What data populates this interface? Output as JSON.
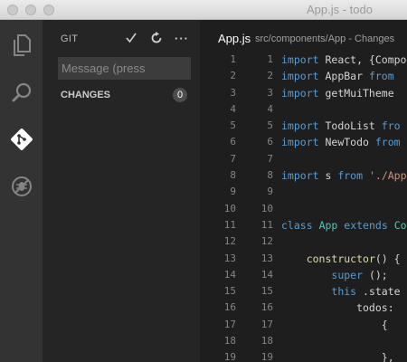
{
  "window": {
    "title": "App.js - todo"
  },
  "activity_bar": {
    "items": [
      {
        "icon": "files-icon",
        "active": false
      },
      {
        "icon": "search-icon",
        "active": false
      },
      {
        "icon": "git-icon",
        "active": true
      },
      {
        "icon": "debug-icon",
        "active": false
      }
    ]
  },
  "sidebar": {
    "title": "GIT",
    "actions": [
      "commit-check-icon",
      "refresh-icon",
      "more-icon"
    ],
    "more_label": "···",
    "message_placeholder": "Message (press",
    "changes_label": "CHANGES",
    "changes_count": "0"
  },
  "editor": {
    "tab_file": "App.js",
    "tab_path": "src/components/App - Changes",
    "lines": [
      {
        "left": "1",
        "right": "1",
        "tokens": [
          [
            "kw",
            "import"
          ],
          [
            "",
            "React, {Compo"
          ]
        ]
      },
      {
        "left": "2",
        "right": "2",
        "tokens": [
          [
            "kw",
            "import"
          ],
          [
            "",
            "AppBar "
          ],
          [
            "kw",
            "from"
          ]
        ]
      },
      {
        "left": "3",
        "right": "3",
        "tokens": [
          [
            "kw",
            "import"
          ],
          [
            "",
            "getMuiTheme "
          ]
        ]
      },
      {
        "left": "4",
        "right": "4",
        "tokens": []
      },
      {
        "left": "5",
        "right": "5",
        "tokens": [
          [
            "kw",
            "import"
          ],
          [
            "",
            "TodoList "
          ],
          [
            "kw",
            "fro"
          ]
        ]
      },
      {
        "left": "6",
        "right": "6",
        "tokens": [
          [
            "kw",
            "import"
          ],
          [
            "",
            "NewTodo "
          ],
          [
            "kw",
            "from"
          ]
        ]
      },
      {
        "left": "7",
        "right": "7",
        "tokens": []
      },
      {
        "left": "8",
        "right": "8",
        "tokens": [
          [
            "kw",
            "import"
          ],
          [
            "",
            "s "
          ],
          [
            "kw",
            "from"
          ],
          [
            "",
            " "
          ],
          [
            "str",
            "'./App"
          ]
        ]
      },
      {
        "left": "9",
        "right": "9",
        "tokens": []
      },
      {
        "left": "10",
        "right": "10",
        "tokens": []
      },
      {
        "left": "11",
        "right": "11",
        "tokens": [
          [
            "kw",
            "class"
          ],
          [
            "",
            " "
          ],
          [
            "cls",
            "App"
          ],
          [
            "",
            " "
          ],
          [
            "kw",
            "extends"
          ],
          [
            "",
            " "
          ],
          [
            "cls",
            "Co"
          ]
        ]
      },
      {
        "left": "12",
        "right": "12",
        "tokens": []
      },
      {
        "left": "13",
        "right": "13",
        "tokens": [
          [
            "",
            "    "
          ],
          [
            "fn",
            "constructor"
          ],
          [
            "",
            "() {"
          ]
        ]
      },
      {
        "left": "14",
        "right": "14",
        "tokens": [
          [
            "",
            "        "
          ],
          [
            "kw",
            "super"
          ],
          [
            "",
            "();"
          ]
        ]
      },
      {
        "left": "15",
        "right": "15",
        "tokens": [
          [
            "",
            "        "
          ],
          [
            "kw",
            "this"
          ],
          [
            "",
            ".state ="
          ]
        ]
      },
      {
        "left": "16",
        "right": "16",
        "tokens": [
          [
            "",
            "            todos:"
          ]
        ]
      },
      {
        "left": "17",
        "right": "17",
        "tokens": [
          [
            "",
            "                {"
          ]
        ]
      },
      {
        "left": "18",
        "right": "18",
        "tokens": []
      },
      {
        "left": "19",
        "right": "19",
        "tokens": [
          [
            "",
            "                },"
          ]
        ]
      }
    ]
  },
  "colors": {
    "keyword": "#569cd6",
    "class_name": "#4ec9b0",
    "string": "#ce9178",
    "function": "#dcdcaa"
  }
}
